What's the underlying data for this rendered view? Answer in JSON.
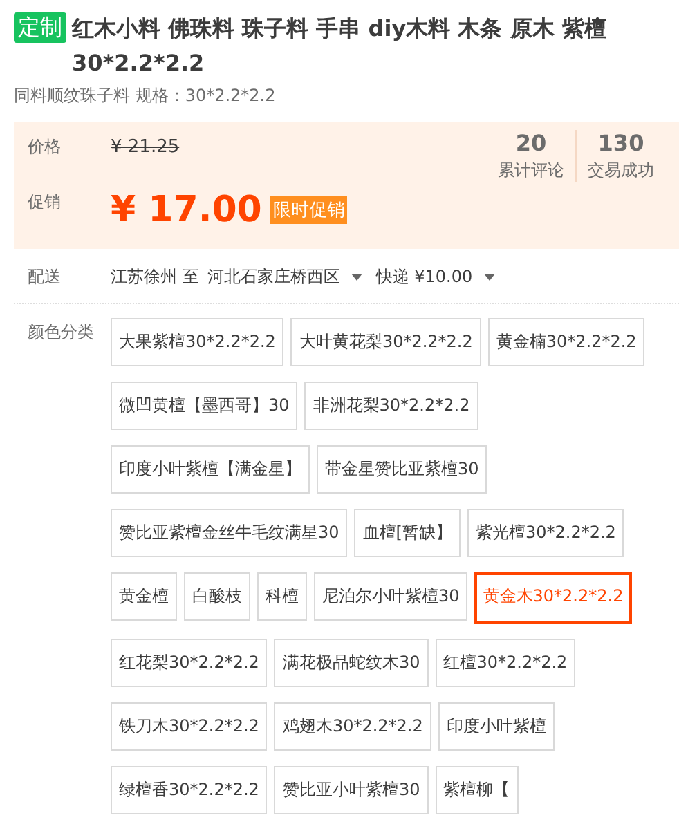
{
  "title": {
    "tag": "定制",
    "text": "红木小料 佛珠料 珠子料 手串 diy木料 木条 原木 紫檀 30*2.2*2.2"
  },
  "subtitle": "同料顺纹珠子料 规格：30*2.2*2.2",
  "price_panel": {
    "price_label": "价格",
    "original_price": "¥ 21.25",
    "promo_label": "促销",
    "promo_price": "¥ 17.00",
    "promo_tag": "限时促销",
    "stats": [
      {
        "value": "20",
        "label": "累计评论"
      },
      {
        "value": "130",
        "label": "交易成功"
      }
    ]
  },
  "delivery": {
    "label": "配送",
    "from": "江苏徐州 至",
    "to": "河北石家庄桥西区",
    "shipping": "快递 ¥10.00"
  },
  "color_options": {
    "label": "颜色分类",
    "rows": [
      {
        "options": [
          {
            "label": "大果紫檀30*2.2*2.2",
            "selected": false
          },
          {
            "label": "大叶黄花梨30*2.2*2.2",
            "selected": false
          },
          {
            "label": "黄金楠30*2.2*2.2",
            "selected": false
          }
        ]
      },
      {
        "options": [
          {
            "label": "微凹黄檀【墨西哥】30",
            "selected": false
          },
          {
            "label": "非洲花梨30*2.2*2.2",
            "selected": false
          }
        ]
      },
      {
        "options": [
          {
            "label": "印度小叶紫檀【满金星】",
            "selected": false
          },
          {
            "label": "带金星赞比亚紫檀30",
            "selected": false
          }
        ]
      },
      {
        "options": [
          {
            "label": "赞比亚紫檀金丝牛毛纹满星30",
            "selected": false
          },
          {
            "label": "血檀[暂缺】",
            "selected": false
          },
          {
            "label": "紫光檀30*2.2*2.2",
            "selected": false
          }
        ]
      },
      {
        "options": [
          {
            "label": "黄金檀",
            "selected": false
          },
          {
            "label": "白酸枝",
            "selected": false
          },
          {
            "label": "科檀",
            "selected": false
          },
          {
            "label": "尼泊尔小叶紫檀30",
            "selected": false
          },
          {
            "label": "黄金木30*2.2*2.2",
            "selected": true
          }
        ]
      },
      {
        "options": [
          {
            "label": "红花梨30*2.2*2.2",
            "selected": false
          },
          {
            "label": "满花极品蛇纹木30",
            "selected": false
          },
          {
            "label": "红檀30*2.2*2.2",
            "selected": false
          }
        ]
      },
      {
        "options": [
          {
            "label": "铁刀木30*2.2*2.2",
            "selected": false
          },
          {
            "label": "鸡翅木30*2.2*2.2",
            "selected": false
          },
          {
            "label": "印度小叶紫檀",
            "selected": false
          }
        ]
      },
      {
        "options": [
          {
            "label": "绿檀香30*2.2*2.2",
            "selected": false
          },
          {
            "label": "赞比亚小叶紫檀30",
            "selected": false
          },
          {
            "label": "紫檀柳【",
            "selected": false
          }
        ]
      }
    ]
  }
}
